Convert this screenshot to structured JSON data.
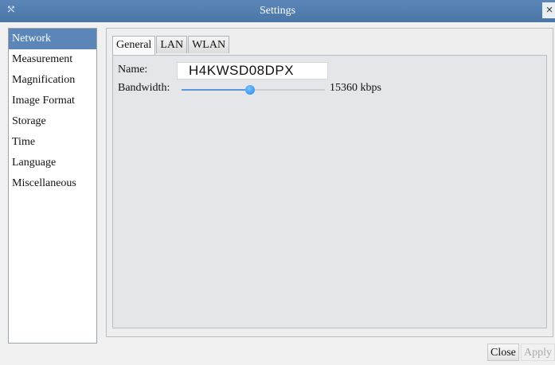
{
  "window": {
    "title": "Settings",
    "icon": "resize-icon",
    "close_label": "×"
  },
  "sidebar": {
    "items": [
      {
        "label": "Network",
        "selected": true
      },
      {
        "label": "Measurement"
      },
      {
        "label": "Magnification"
      },
      {
        "label": "Image Format"
      },
      {
        "label": "Storage"
      },
      {
        "label": "Time"
      },
      {
        "label": "Language"
      },
      {
        "label": "Miscellaneous"
      }
    ]
  },
  "tabs": [
    {
      "label": "General",
      "active": true
    },
    {
      "label": "LAN"
    },
    {
      "label": "WLAN"
    }
  ],
  "general": {
    "name_label": "Name:",
    "name_value": "H4KWSD08DPX",
    "bandwidth_label": "Bandwidth:",
    "bandwidth_value": "15360 kbps",
    "bandwidth_slider_fraction": 0.48
  },
  "footer": {
    "close_label": "Close",
    "apply_label": "Apply"
  },
  "colors": {
    "accent": "#5b86b7",
    "slider": "#1f86e8"
  }
}
